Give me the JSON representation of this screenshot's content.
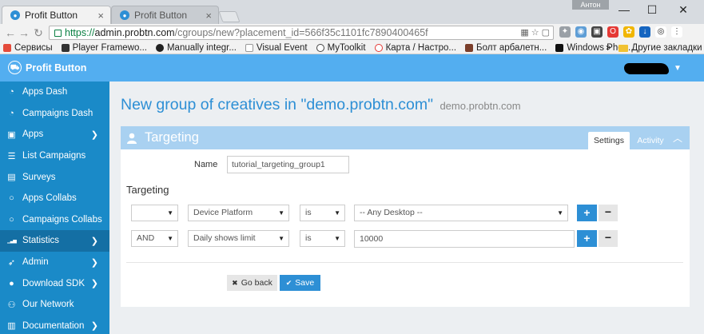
{
  "browser": {
    "tabs": [
      {
        "label": "Profit Button",
        "active": true
      },
      {
        "label": "Profit Button",
        "active": false
      }
    ],
    "user_badge": "Антон",
    "window_controls": {
      "minimize": "—",
      "maximize": "☐",
      "close": "✕"
    },
    "url": {
      "scheme": "https://",
      "host": "admin.probtn.com",
      "path": "/cgroups/new?placement_id=566f35c1101fc7890400465f"
    },
    "bookmarks": [
      {
        "label": "Сервисы",
        "color": "#e44b3b"
      },
      {
        "label": "Player Framewo...",
        "color": "#333333"
      },
      {
        "label": "Manually integr...",
        "color": "#222222"
      },
      {
        "label": "Visual Event",
        "color": "#bbbbbb"
      },
      {
        "label": "MyToolkit",
        "color": "#444444"
      },
      {
        "label": "Карта / Настро...",
        "color": "#e53935"
      },
      {
        "label": "Болт арбалетн...",
        "color": "#7b3f2b"
      },
      {
        "label": "Windows Phon...",
        "color": "#111111"
      }
    ],
    "bookmarks_overflow": "»",
    "other_bookmarks": "Другие закладки"
  },
  "app": {
    "logo_text": "Profit Button",
    "accent": "#2d8fd5",
    "header_color": "#53aef0",
    "sidebar_color": "#1a8ac8"
  },
  "sidebar": {
    "items": [
      {
        "label": "Apps Dash",
        "icon": "dashboard-icon",
        "glyph": "◔",
        "chevron": false
      },
      {
        "label": "Campaigns Dash",
        "icon": "dashboard-icon",
        "glyph": "◔",
        "chevron": false
      },
      {
        "label": "Apps",
        "icon": "briefcase-icon",
        "glyph": "▣",
        "chevron": true
      },
      {
        "label": "List Campaigns",
        "icon": "list-icon",
        "glyph": "☰",
        "chevron": false
      },
      {
        "label": "Surveys",
        "icon": "chart-icon",
        "glyph": "▤",
        "chevron": false
      },
      {
        "label": "Apps Collabs",
        "icon": "circle-icon",
        "glyph": "○",
        "chevron": false
      },
      {
        "label": "Campaigns Collabs",
        "icon": "circle-icon",
        "glyph": "○",
        "chevron": false
      },
      {
        "label": "Statistics",
        "icon": "signal-icon",
        "glyph": "▁▃▅",
        "chevron": true,
        "active": true
      },
      {
        "label": "Admin",
        "icon": "rocket-icon",
        "glyph": "➶",
        "chevron": true
      },
      {
        "label": "Download SDK",
        "icon": "github-icon",
        "glyph": "●",
        "chevron": true
      },
      {
        "label": "Our Network",
        "icon": "users-icon",
        "glyph": "⚇",
        "chevron": false
      },
      {
        "label": "Documentation",
        "icon": "book-icon",
        "glyph": "▥",
        "chevron": true
      }
    ]
  },
  "main": {
    "title": "New group of creatives in \"demo.probtn.com\"",
    "subtitle": "demo.probtn.com",
    "panel": {
      "title": "Targeting",
      "tabs": [
        "Settings",
        "Activity"
      ],
      "active_tab": "Settings"
    },
    "name_label": "Name",
    "name_value": "tutorial_targeting_group1",
    "targeting_label": "Targeting",
    "rows": [
      {
        "logic": "",
        "field": "Device Platform",
        "operator": "is",
        "value": "-- Any Desktop --",
        "value_type": "select"
      },
      {
        "logic": "AND",
        "field": "Daily shows limit",
        "operator": "is",
        "value": "10000",
        "value_type": "input"
      }
    ],
    "add_symbol": "+",
    "remove_symbol": "−",
    "back_label": "Go back",
    "save_label": "Save"
  }
}
